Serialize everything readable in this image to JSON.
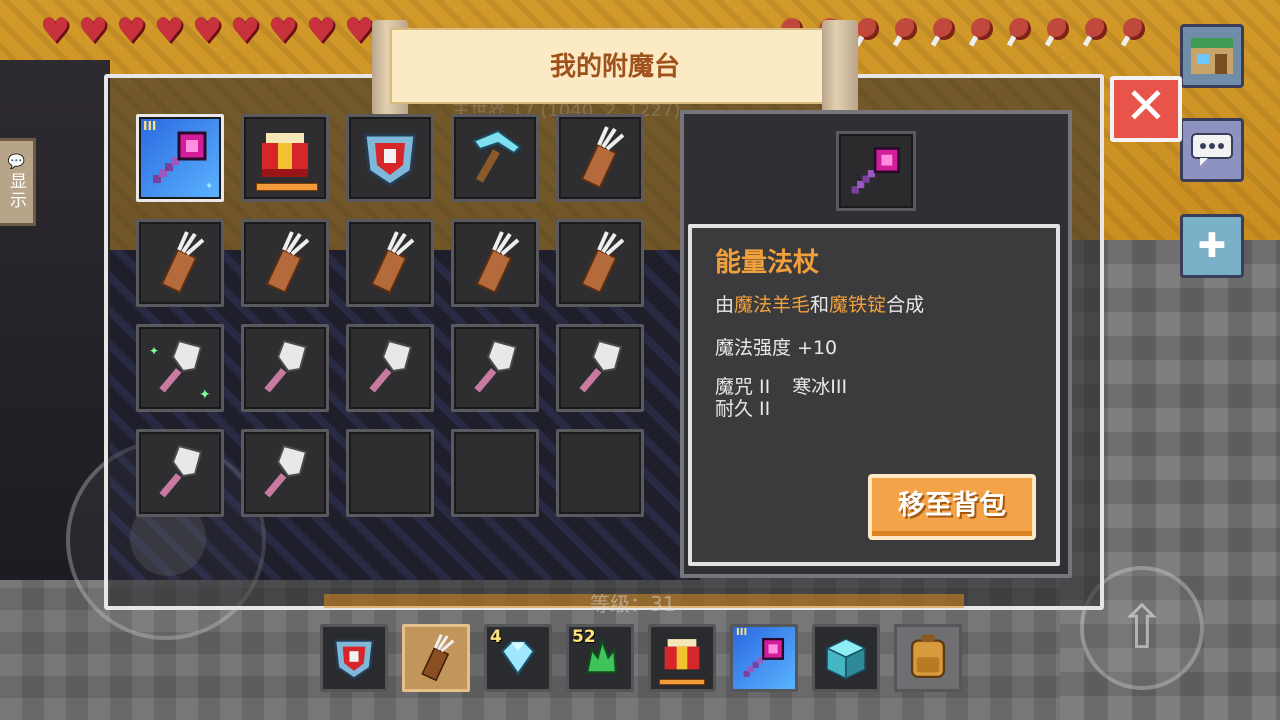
{
  "title": "我的附魔台",
  "ghost_coords": "主世界 17 (1040, 2, 1227)",
  "side_buttons": {
    "show_label": "显示"
  },
  "grid_slots": [
    {
      "icon": "magic-staff-icon",
      "tier": "III",
      "selected": true
    },
    {
      "icon": "red-chestplate-icon",
      "durability": 1.0
    },
    {
      "icon": "shield-banner-icon"
    },
    {
      "icon": "diamond-pickaxe-icon"
    },
    {
      "icon": "arrow-quiver-icon"
    },
    {
      "icon": "arrow-quiver-icon"
    },
    {
      "icon": "arrow-quiver-icon"
    },
    {
      "icon": "arrow-quiver-icon"
    },
    {
      "icon": "arrow-quiver-icon"
    },
    {
      "icon": "arrow-quiver-icon"
    },
    {
      "icon": "shovel-icon",
      "enchanted": true
    },
    {
      "icon": "shovel-icon"
    },
    {
      "icon": "shovel-icon"
    },
    {
      "icon": "shovel-icon"
    },
    {
      "icon": "shovel-icon"
    },
    {
      "icon": "shovel-icon"
    },
    {
      "icon": "shovel-icon"
    },
    {
      "icon": "empty"
    },
    {
      "icon": "empty"
    },
    {
      "icon": "empty"
    }
  ],
  "detail": {
    "name": "能量法杖",
    "recipe_prefix": "由",
    "recipe_item1": "魔法羊毛",
    "recipe_mid": "和",
    "recipe_item2": "魔铁锭",
    "recipe_suffix": "合成",
    "stat": "魔法强度 +10",
    "ench_1": "魔咒 II",
    "ench_2": "寒冰III",
    "ench_3": "耐久 II",
    "move_button": "移至背包"
  },
  "level": {
    "text": "等级：31",
    "value": "200/200"
  },
  "hotbar": [
    {
      "icon": "shield-banner-icon"
    },
    {
      "icon": "arrow-quiver-icon",
      "active": true
    },
    {
      "icon": "diamond-gem-icon",
      "count": "4"
    },
    {
      "icon": "emerald-crystal-icon",
      "count": "52"
    },
    {
      "icon": "red-chestplate-icon",
      "durability": 1.0
    },
    {
      "icon": "magic-staff-icon",
      "tier": "III"
    },
    {
      "icon": "glass-block-icon"
    },
    {
      "icon": "backpack-icon"
    }
  ],
  "colors": {
    "accent_orange": "#f2a13a",
    "close_red": "#e8534a",
    "selected_blue": "#2a68e0",
    "title_brown": "#a0521c"
  }
}
